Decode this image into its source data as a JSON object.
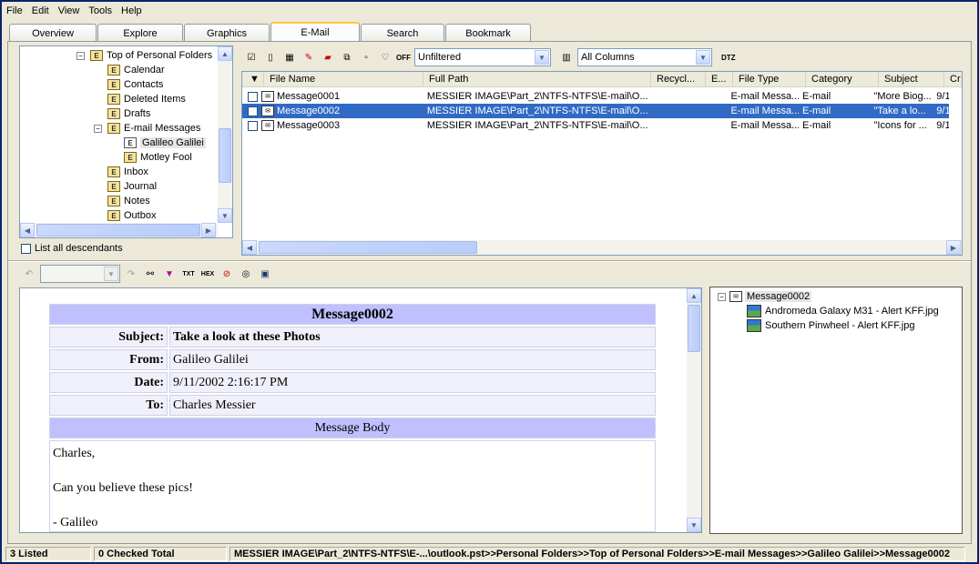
{
  "menu": [
    "File",
    "Edit",
    "View",
    "Tools",
    "Help"
  ],
  "tabs": [
    "Overview",
    "Explore",
    "Graphics",
    "E-Mail",
    "Search",
    "Bookmark"
  ],
  "active_tab": "E-Mail",
  "tree": {
    "items": [
      "Top of Personal Folders",
      "Calendar",
      "Contacts",
      "Deleted Items",
      "Drafts",
      "E-mail Messages",
      "Galileo Galilei",
      "Motley Fool",
      "Inbox",
      "Journal",
      "Notes",
      "Outbox"
    ],
    "list_all_descendants": "List all descendants",
    "expand_minus": "−"
  },
  "toolbar": {
    "off_label": "OFF",
    "filter_value": "Unfiltered",
    "columns_value": "All Columns",
    "dtz_label": "DTZ"
  },
  "grid": {
    "columns": [
      "File Name",
      "Full Path",
      "Recycl...",
      "E...",
      "File Type",
      "Category",
      "Subject",
      "Cr"
    ],
    "rows": [
      {
        "name": "Message0001",
        "path": "MESSIER IMAGE\\Part_2\\NTFS-NTFS\\E-mail\\O...",
        "type": "E-mail Messa...",
        "category": "E-mail",
        "subject": "\"More Biog...",
        "created": "9/1"
      },
      {
        "name": "Message0002",
        "path": "MESSIER IMAGE\\Part_2\\NTFS-NTFS\\E-mail\\O...",
        "type": "E-mail Messa...",
        "category": "E-mail",
        "subject": "\"Take a lo...",
        "created": "9/1"
      },
      {
        "name": "Message0003",
        "path": "MESSIER IMAGE\\Part_2\\NTFS-NTFS\\E-mail\\O...",
        "type": "E-mail Messa...",
        "category": "E-mail",
        "subject": "\"Icons for ...",
        "created": "9/1"
      }
    ],
    "selected_row": 1
  },
  "message": {
    "title": "Message0002",
    "labels": {
      "subject": "Subject:",
      "from": "From:",
      "date": "Date:",
      "to": "To:"
    },
    "subject": "Take a look at these Photos",
    "from": "Galileo Galilei",
    "date": "9/11/2002 2:16:17 PM",
    "to": "Charles Messier",
    "body_header": "Message Body",
    "body_lines": [
      "Charles,",
      "Can you believe these pics!",
      "- Galileo"
    ]
  },
  "attachments": {
    "root": "Message0002",
    "items": [
      "Andromeda Galaxy M31 - Alert KFF.jpg",
      "Southern Pinwheel - Alert KFF.jpg"
    ]
  },
  "status": {
    "listed": "3 Listed",
    "checked": "0 Checked Total",
    "path": "MESSIER IMAGE\\Part_2\\NTFS-NTFS\\E-...\\outlook.pst>>Personal Folders>>Top of Personal Folders>>E-mail Messages>>Galileo Galilei>>Message0002"
  },
  "colors": {
    "selection": "#316ac5",
    "header_band": "#c0c0ff",
    "tab_highlight": "#ffc83c"
  }
}
